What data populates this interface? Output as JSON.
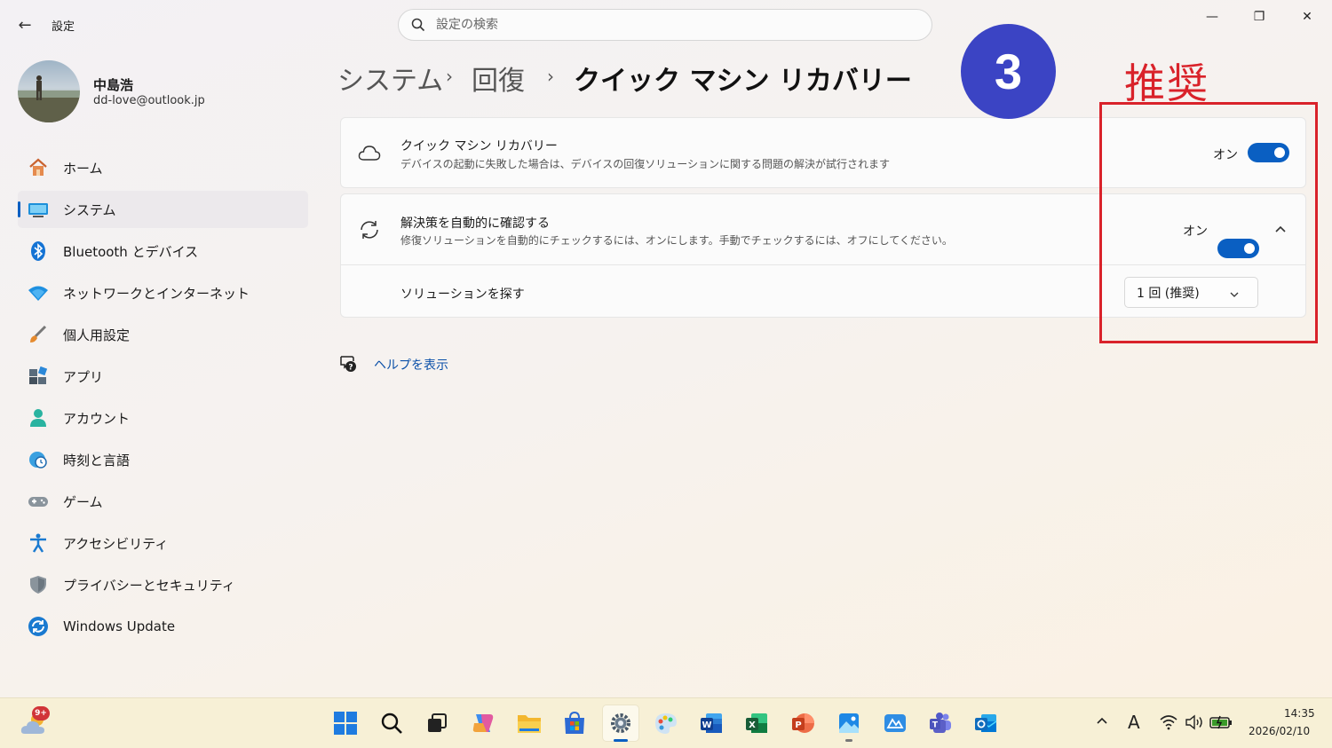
{
  "window": {
    "title": "設定",
    "back_label": "←",
    "minimize": "—",
    "maximize": "❐",
    "close": "✕"
  },
  "search": {
    "placeholder": "設定の検索"
  },
  "profile": {
    "name": "中島浩",
    "email": "dd-love@outlook.jp"
  },
  "sidebar": {
    "items": [
      {
        "label": "ホーム",
        "icon": "home-icon"
      },
      {
        "label": "システム",
        "icon": "system-icon",
        "active": true
      },
      {
        "label": "Bluetooth とデバイス",
        "icon": "bluetooth-icon"
      },
      {
        "label": "ネットワークとインターネット",
        "icon": "wifi-icon"
      },
      {
        "label": "個人用設定",
        "icon": "brush-icon"
      },
      {
        "label": "アプリ",
        "icon": "apps-icon"
      },
      {
        "label": "アカウント",
        "icon": "account-icon"
      },
      {
        "label": "時刻と言語",
        "icon": "clock-globe-icon"
      },
      {
        "label": "ゲーム",
        "icon": "gamepad-icon"
      },
      {
        "label": "アクセシビリティ",
        "icon": "accessibility-icon"
      },
      {
        "label": "プライバシーとセキュリティ",
        "icon": "shield-icon"
      },
      {
        "label": "Windows Update",
        "icon": "windows-update-icon"
      }
    ]
  },
  "breadcrumb": {
    "items": [
      "システム",
      "回復",
      "クイック マシン リカバリー"
    ],
    "separator": "›"
  },
  "settings": {
    "quick_recovery": {
      "title": "クイック マシン リカバリー",
      "description": "デバイスの起動に失敗した場合は、デバイスの回復ソリューションに関する問題の解決が試行されます",
      "state": "オン",
      "on": true
    },
    "auto_check": {
      "title": "解決策を自動的に確認する",
      "description": "修復ソリューションを自動的にチェックするには、オンにします。手動でチェックするには、オフにしてください。",
      "state": "オン",
      "on": true,
      "expanded": true
    },
    "find_solution": {
      "label": "ソリューションを探す",
      "selected": "1 回 (推奨)"
    }
  },
  "help": {
    "label": "ヘルプを表示"
  },
  "annotation": {
    "step_number": "3",
    "label": "推奨",
    "color": "#d9222a",
    "circle_color": "#3b44c4"
  },
  "taskbar": {
    "weather_badge": "9+",
    "ime_label": "A",
    "time": "14:35",
    "date": "2026/02/10",
    "apps": [
      "start-icon",
      "search-icon",
      "task-view-icon",
      "copilot-icon",
      "file-explorer-icon",
      "store-icon",
      "settings-icon",
      "paint-icon",
      "word-icon",
      "excel-icon",
      "powerpoint-icon",
      "photos-icon",
      "app-icon",
      "teams-icon",
      "outlook-icon"
    ]
  },
  "accent_color": "#0a5fc2"
}
